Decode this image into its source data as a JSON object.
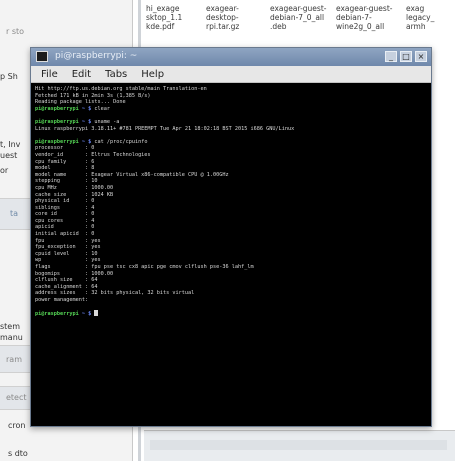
{
  "desktop": {
    "sidebar": {
      "items": [
        {
          "label": "r sto"
        },
        {
          "label": "p Sh"
        },
        {
          "label": "t, Inv"
        },
        {
          "label": "uest"
        },
        {
          "label": "or"
        },
        {
          "label": "ta"
        },
        {
          "label": "stem"
        },
        {
          "label": "manu"
        },
        {
          "label": "ram"
        },
        {
          "label": "etect"
        },
        {
          "label": "cron"
        },
        {
          "label": "s dto"
        }
      ]
    },
    "files": [
      {
        "name": "hi_exage\nsktop_1.1\nkde.pdf"
      },
      {
        "name": "exagear-\ndesktop-\nrpi.tar.gz"
      },
      {
        "name": "exagear-guest-\ndebian-7_0_all\n.deb"
      },
      {
        "name": "exagear-guest-\ndebian-7-\nwine2g_0_all"
      },
      {
        "name": "exag\nlegacy_\narmh"
      }
    ]
  },
  "terminal": {
    "title": "pi@raspberrypi: ~",
    "menu": [
      "File",
      "Edit",
      "Tabs",
      "Help"
    ],
    "window_buttons": [
      "_",
      "□",
      "×"
    ],
    "lines": [
      {
        "text": "Hit http://ftp.us.debian.org stable/main Translation-en"
      },
      {
        "text": "Fetched 171 kB in 2min 3s (1,385 B/s)"
      },
      {
        "text": "Reading package lists... Done"
      },
      {
        "prompt": "pi@raspberrypi",
        "path": "~ $",
        "cmd": " clear"
      },
      {
        "text": ""
      },
      {
        "prompt": "pi@raspberrypi",
        "path": "~ $",
        "cmd": " uname -a"
      },
      {
        "text": "Linux raspberrypi 3.18.11+ #781 PREEMPT Tue Apr 21 18:02:18 BST 2015 i686 GNU/Linux"
      },
      {
        "text": ""
      },
      {
        "prompt": "pi@raspberrypi",
        "path": "~ $",
        "cmd": " cat /proc/cpuinfo"
      },
      {
        "text": "processor       : 0"
      },
      {
        "text": "vendor_id       : Eltrus Technologies"
      },
      {
        "text": "cpu family      : 6"
      },
      {
        "text": "model           : 8"
      },
      {
        "text": "model name      : Exagear Virtual x86-compatible CPU @ 1.00GHz"
      },
      {
        "text": "stepping        : 10"
      },
      {
        "text": "cpu MHz         : 1000.00"
      },
      {
        "text": "cache size      : 1024 KB"
      },
      {
        "text": "physical id     : 0"
      },
      {
        "text": "siblings        : 4"
      },
      {
        "text": "core id         : 0"
      },
      {
        "text": "cpu cores       : 4"
      },
      {
        "text": "apicid          : 0"
      },
      {
        "text": "initial apicid  : 0"
      },
      {
        "text": "fpu             : yes"
      },
      {
        "text": "fpu_exception   : yes"
      },
      {
        "text": "cpuid level     : 10"
      },
      {
        "text": "wp              : yes"
      },
      {
        "text": "flags           : fpu pse tsc cx8 apic pge cmov clflush pse-36 lahf_lm"
      },
      {
        "text": "bogomips        : 1000.00"
      },
      {
        "text": "clflush size    : 64"
      },
      {
        "text": "cache_alignment : 64"
      },
      {
        "text": "address sizes   : 32 bits physical, 32 bits virtual"
      },
      {
        "text": "power management:"
      },
      {
        "text": ""
      },
      {
        "prompt": "pi@raspberrypi",
        "path": "~ $",
        "cmd": " ",
        "cursor": true
      }
    ]
  }
}
